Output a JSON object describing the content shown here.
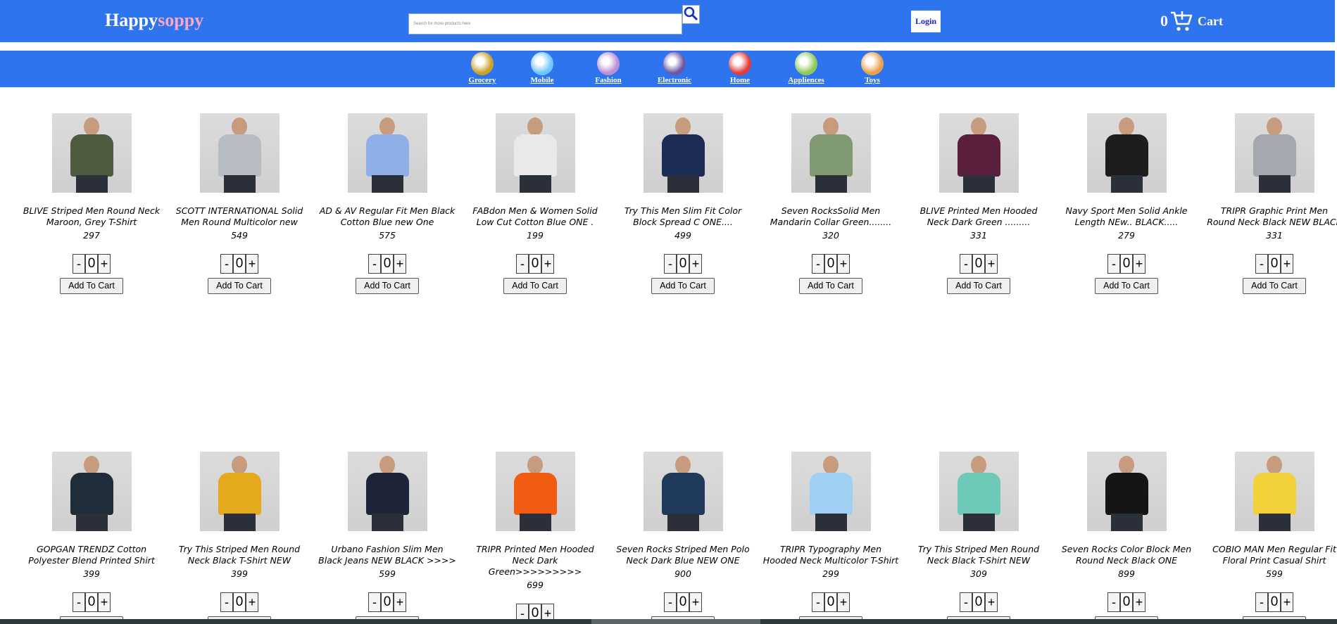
{
  "header": {
    "brand_part1": "Happy",
    "brand_part2": "soppy",
    "search_placeholder": "Search for more products here",
    "search_icon": "search-icon",
    "login_label": "Login",
    "cart_count": "0",
    "cart_icon": "cart-icon",
    "cart_label": "Cart"
  },
  "categories": [
    {
      "label": "Grocery",
      "icon": "grocery-icon",
      "color": "#c9a227"
    },
    {
      "label": "Mobile",
      "icon": "mobile-icon",
      "color": "#6fc6ff"
    },
    {
      "label": "Fashion",
      "icon": "fashion-icon",
      "color": "#b98fd6"
    },
    {
      "label": "Electronic",
      "icon": "electronic-icon",
      "color": "#6b57a6"
    },
    {
      "label": "Home",
      "icon": "home-icon",
      "color": "#e23b3b"
    },
    {
      "label": "Appliences",
      "icon": "appliances-icon",
      "color": "#8fc95a"
    },
    {
      "label": "Toys",
      "icon": "toys-icon",
      "color": "#e8a04c"
    }
  ],
  "products_row1": [
    {
      "name": "BLIVE Striped Men Round Neck Maroon, Grey T-Shirt",
      "price": "297",
      "qty": "0",
      "color": "#4e5b3e"
    },
    {
      "name": "SCOTT INTERNATIONAL Solid Men Round Multicolor new",
      "price": "549",
      "qty": "0",
      "color": "#b7bcc2"
    },
    {
      "name": "AD & AV Regular Fit Men Black Cotton Blue new One",
      "price": "575",
      "qty": "0",
      "color": "#8fb0e6"
    },
    {
      "name": "FABdon Men & Women Solid Low Cut Cotton Blue ONE .",
      "price": "199",
      "qty": "0",
      "color": "#e9e9e9"
    },
    {
      "name": "Try This Men Slim Fit Color Block Spread C ONE....",
      "price": "499",
      "qty": "0",
      "color": "#1d2c56"
    },
    {
      "name": "Seven RocksSolid Men Mandarin Collar Green........",
      "price": "320",
      "qty": "0",
      "color": "#7f9a72"
    },
    {
      "name": "BLIVE Printed Men Hooded Neck Dark Green .........",
      "price": "331",
      "qty": "0",
      "color": "#5a1f3d"
    },
    {
      "name": "Navy Sport Men Solid Ankle Length NEw.. BLACK.....",
      "price": "279",
      "qty": "0",
      "color": "#1d1d1d"
    },
    {
      "name": "TRIPR Graphic Print Men Round Neck Black NEW BLACK",
      "price": "331",
      "qty": "0",
      "color": "#a3a8ae"
    }
  ],
  "products_row2": [
    {
      "name": "GOPGAN TRENDZ Cotton Polyester Blend Printed Shirt",
      "price": "399",
      "qty": "0",
      "color": "#1f2d3a"
    },
    {
      "name": "Try This Striped Men Round Neck Black T-Shirt NEW",
      "price": "399",
      "qty": "0",
      "color": "#e4a91d"
    },
    {
      "name": "Urbano Fashion Slim Men Black Jeans NEW BLACK >>>>",
      "price": "599",
      "qty": "0",
      "color": "#1e2438"
    },
    {
      "name": "TRIPR Printed Men Hooded Neck Dark Green>>>>>>>>>",
      "price": "699",
      "qty": "0",
      "color": "#f25b12"
    },
    {
      "name": "Seven Rocks Striped Men Polo Neck Dark Blue NEW ONE",
      "price": "900",
      "qty": "0",
      "color": "#1f3a5a"
    },
    {
      "name": "TRIPR Typography Men Hooded Neck Multicolor T-Shirt",
      "price": "299",
      "qty": "0",
      "color": "#9fd0f4"
    },
    {
      "name": "Try This Striped Men Round Neck Black T-Shirt NEW",
      "price": "309",
      "qty": "0",
      "color": "#6fc9b8"
    },
    {
      "name": "Seven Rocks Color Block Men Round Neck Black ONE",
      "price": "899",
      "qty": "0",
      "color": "#151515"
    },
    {
      "name": "COBIO MAN Men Regular Fit Floral Print Casual Shirt",
      "price": "599",
      "qty": "0",
      "color": "#f1d23a"
    }
  ],
  "add_to_cart_label": "Add To Cart",
  "minus_label": "-",
  "plus_label": "+"
}
